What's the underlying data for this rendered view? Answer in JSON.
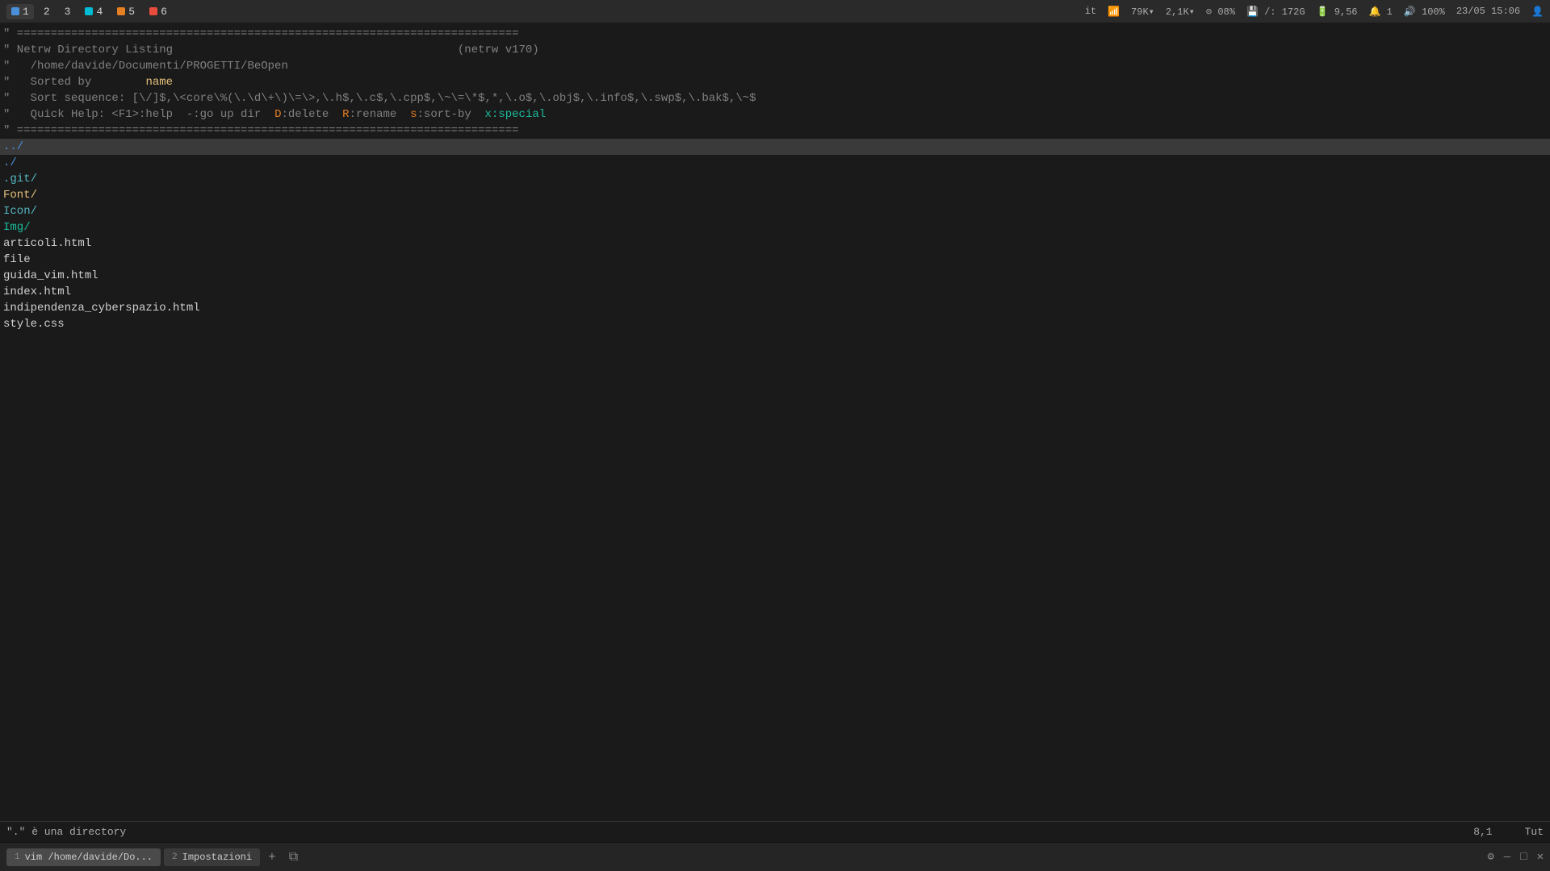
{
  "topbar": {
    "tabs": [
      {
        "num": "1",
        "dot_class": "dot-blue",
        "label": "",
        "active": true
      },
      {
        "num": "2",
        "dot_class": "",
        "label": "",
        "active": false
      },
      {
        "num": "3",
        "dot_class": "",
        "label": "",
        "active": false
      },
      {
        "num": "4",
        "dot_class": "dot-cyan",
        "label": "",
        "active": false
      },
      {
        "num": "5",
        "dot_class": "dot-orange",
        "label": "",
        "active": false
      },
      {
        "num": "6",
        "dot_class": "dot-red",
        "label": "",
        "active": false
      }
    ],
    "status": {
      "keyboard": "it",
      "wifi": "📶",
      "mem": "79K▾",
      "net": "2,1K▾",
      "cpu_icon": "⊙",
      "cpu": "08%",
      "disk_icon": "💾",
      "disk": "/: 172G",
      "bat_icon": "🔋",
      "bat": "9,56",
      "notif": "1",
      "vol": "100%",
      "time": "23/05 15:06"
    }
  },
  "editor": {
    "header_lines": [
      {
        "text": "\" ==========================================================================",
        "color": "comment"
      },
      {
        "text": "\" Netrw Directory Listing                                          (netrw v170)",
        "color": "comment"
      },
      {
        "text": "\"   /home/davide/Documenti/PROGETTI/BeOpen",
        "color": "comment"
      },
      {
        "text": "\"   Sorted by        name",
        "parts": [
          {
            "text": "\"   Sorted by        ",
            "color": "comment"
          },
          {
            "text": "name",
            "color": "yellow"
          }
        ]
      },
      {
        "text": "\"   Sort sequence: [\\/]$,\\<core\\%(\\.\\d\\+\\)\\=\\>\\,\\.h$,\\.c$,\\.cpp$,\\~\\=\\*$,*,\\.o$,\\.obj$,\\.info$,\\.swp$,\\.bak$,\\~$",
        "color": "comment"
      },
      {
        "text": "\"   Quick Help: <F1>:help  -:go up dir  D:delete  R:rename  s:sort-by  x:special",
        "parts": [
          {
            "text": "\"   Quick Help: ",
            "color": "comment"
          },
          {
            "text": "<F1>",
            "color": "comment"
          },
          {
            "text": ":help  ",
            "color": "comment"
          },
          {
            "text": "-",
            "color": "comment"
          },
          {
            "text": ":go up dir  ",
            "color": "comment"
          },
          {
            "text": "D",
            "color": "orange"
          },
          {
            "text": ":delete  ",
            "color": "comment"
          },
          {
            "text": "R",
            "color": "orange"
          },
          {
            "text": ":rename  ",
            "color": "comment"
          },
          {
            "text": "s",
            "color": "orange"
          },
          {
            "text": ":sort-by  ",
            "color": "comment"
          },
          {
            "text": "x",
            "color": "teal"
          },
          {
            "text": ":special",
            "color": "teal"
          }
        ]
      },
      {
        "text": "\" ==========================================================================",
        "color": "comment"
      }
    ],
    "dir_entries": [
      {
        "text": "../",
        "color": "blue",
        "selected": true
      },
      {
        "text": "./",
        "color": "blue"
      },
      {
        "text": ".git/",
        "color": "cyan"
      },
      {
        "text": "Font/",
        "color": "yellow"
      },
      {
        "text": "Icon/",
        "color": "cyan"
      },
      {
        "text": "Img/",
        "color": "teal"
      },
      {
        "text": "articoli.html",
        "color": "white"
      },
      {
        "text": "file",
        "color": "white"
      },
      {
        "text": "guida_vim.html",
        "color": "white"
      },
      {
        "text": "index.html",
        "color": "white"
      },
      {
        "text": "indipendenza_cyberspazio.html",
        "color": "white"
      },
      {
        "text": "style.css",
        "color": "white"
      }
    ]
  },
  "statusbar": {
    "left": "\".\" è una directory",
    "pos": "8,1",
    "mode": "Tut"
  },
  "taskbar": {
    "tabs": [
      {
        "num": "1",
        "label": "vim /home/davide/Do...",
        "active": true
      },
      {
        "num": "2",
        "label": "Impostazioni",
        "active": false
      }
    ],
    "add_label": "+",
    "window_btn": "⧉"
  }
}
